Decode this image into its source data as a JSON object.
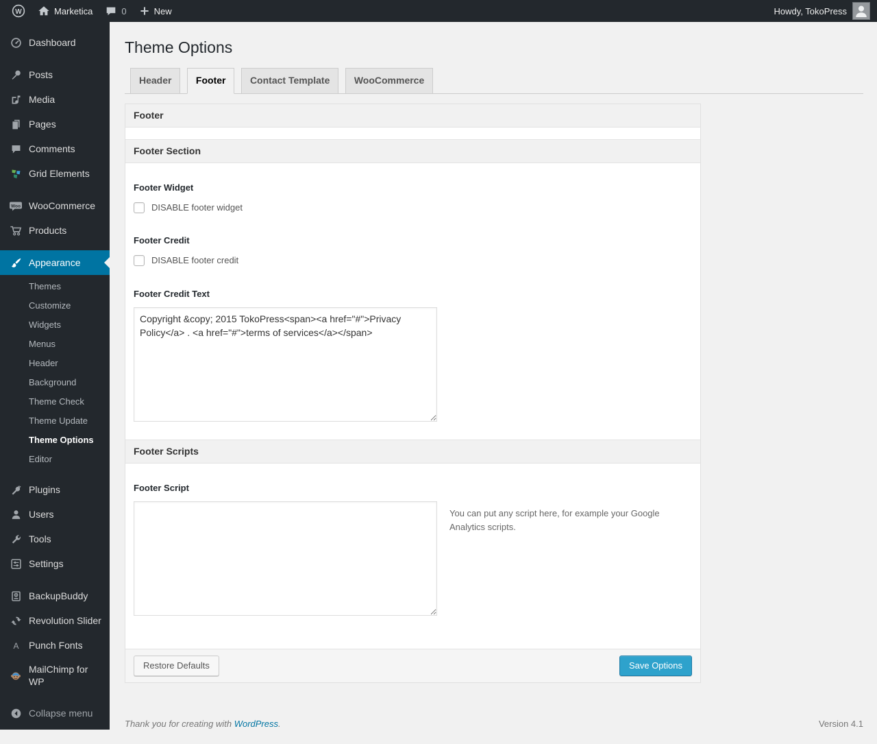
{
  "colors": {
    "accent_blue": "#0074a2",
    "primary_button": "#2ea2cc",
    "dark_chrome": "#23282d",
    "page_background": "#f1f1f1"
  },
  "admin_bar": {
    "site_name": "Marketica",
    "comment_count": "0",
    "new_label": "New",
    "howdy": "Howdy, TokoPress"
  },
  "icons": {
    "wp_logo_glyph": "W",
    "woo_badge_text": "Woo",
    "punch_fonts_glyph": "A"
  },
  "sidebar": {
    "menu": {
      "dashboard": "Dashboard",
      "posts": "Posts",
      "media": "Media",
      "pages": "Pages",
      "comments": "Comments",
      "grid_elements": "Grid Elements",
      "woocommerce": "WooCommerce",
      "products": "Products",
      "appearance": "Appearance",
      "appearance_submenu": [
        "Themes",
        "Customize",
        "Widgets",
        "Menus",
        "Header",
        "Background",
        "Theme Check",
        "Theme Update",
        "Theme Options",
        "Editor"
      ],
      "plugins": "Plugins",
      "users": "Users",
      "tools": "Tools",
      "settings": "Settings",
      "backupbuddy": "BackupBuddy",
      "revolution_slider": "Revolution Slider",
      "punch_fonts": "Punch Fonts",
      "mailchimp": "MailChimp for WP",
      "collapse": "Collapse menu"
    }
  },
  "main": {
    "page_title": "Theme Options",
    "tabs": [
      {
        "label": "Header"
      },
      {
        "label": "Footer"
      },
      {
        "label": "Contact Template"
      },
      {
        "label": "WooCommerce"
      }
    ],
    "panel_title": "Footer",
    "section_titles": {
      "footer_section": "Footer Section",
      "footer_scripts": "Footer Scripts"
    },
    "fields": {
      "footer_widget_label": "Footer Widget",
      "footer_widget_checkbox": "DISABLE footer widget",
      "footer_credit_label": "Footer Credit",
      "footer_credit_checkbox": "DISABLE footer credit",
      "footer_credit_text_label": "Footer Credit Text",
      "footer_credit_text_value": "Copyright &copy; 2015 TokoPress<span><a href=\"#\">Privacy Policy</a> . <a href=\"#\">terms of services</a></span>",
      "footer_script_label": "Footer Script",
      "footer_script_value": "",
      "footer_script_help": "You can put any script here, for example your Google Analytics scripts."
    },
    "actions": {
      "restore_label": "Restore Defaults",
      "save_label": "Save Options"
    }
  },
  "footer": {
    "thanks_text": "Thank you for creating with",
    "wordpress_link": "WordPress",
    "suffix": ".",
    "version": "Version 4.1"
  }
}
